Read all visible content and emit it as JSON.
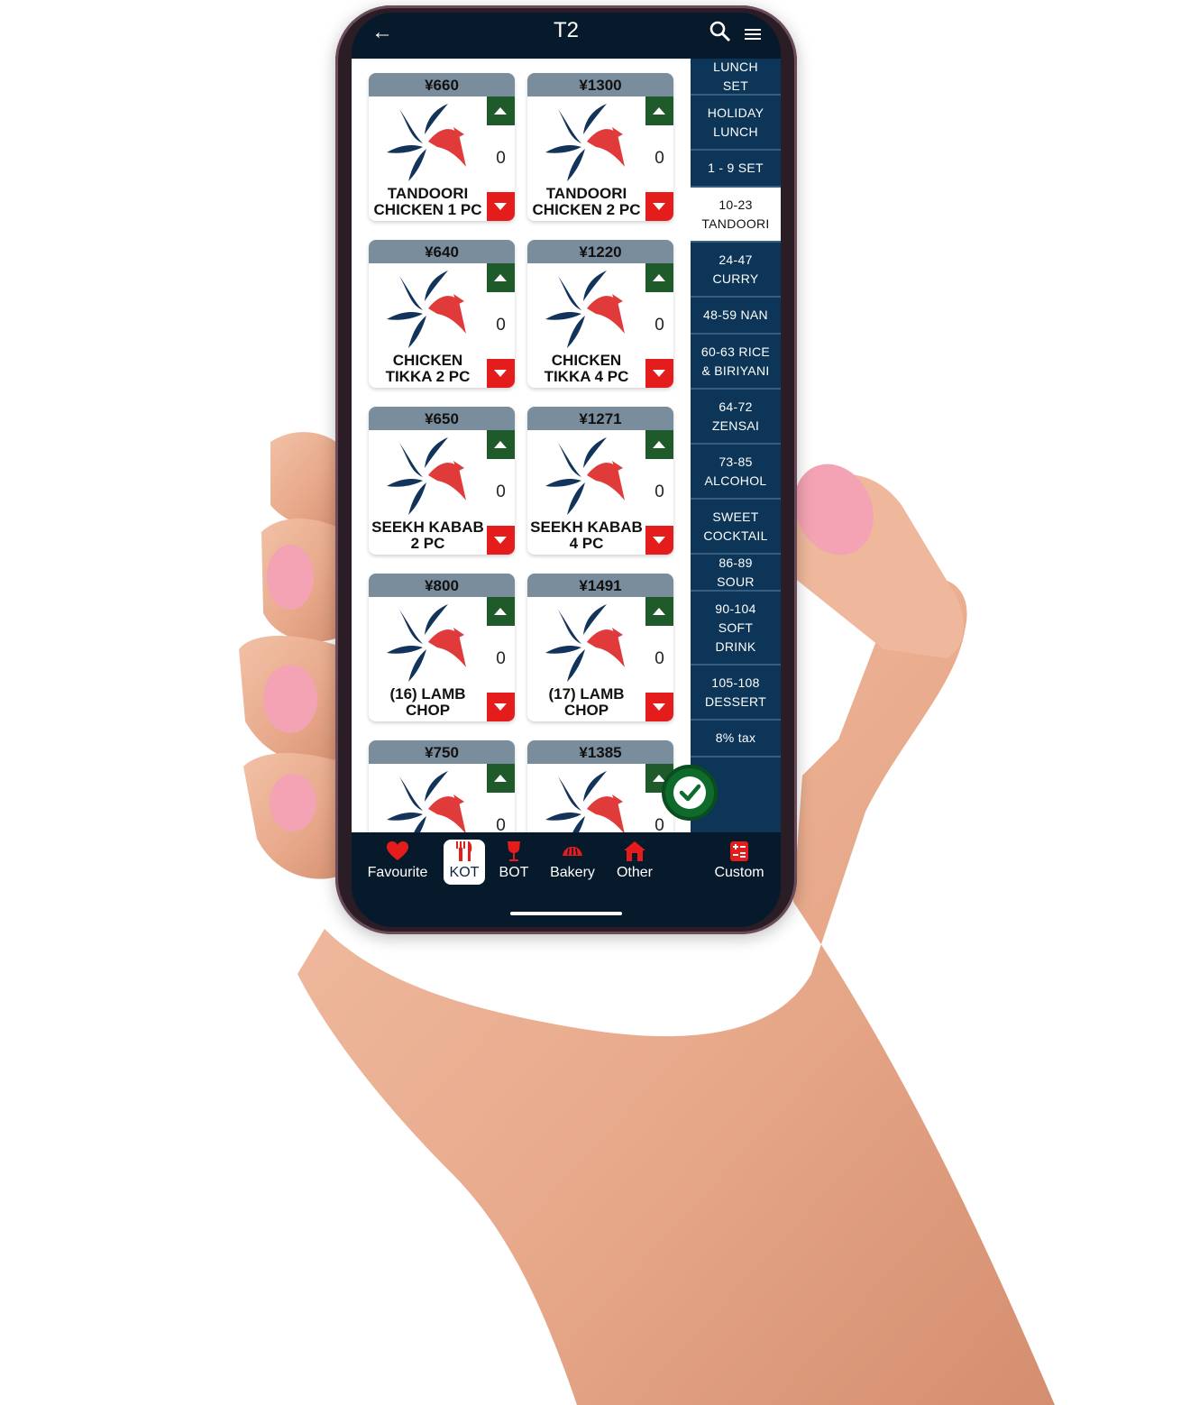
{
  "header": {
    "title": "T2",
    "back_icon": "back-arrow-icon",
    "search_icon": "search-icon",
    "menu_icon": "list-menu-icon"
  },
  "products": [
    {
      "price": "¥660",
      "name": "TANDOORI CHICKEN 1 PC",
      "qty": "0"
    },
    {
      "price": "¥1300",
      "name": "TANDOORI CHICKEN 2 PC",
      "qty": "0"
    },
    {
      "price": "¥640",
      "name": "CHICKEN TIKKA 2 PC",
      "qty": "0"
    },
    {
      "price": "¥1220",
      "name": "CHICKEN TIKKA 4 PC",
      "qty": "0"
    },
    {
      "price": "¥650",
      "name": "SEEKH KABAB 2 PC",
      "qty": "0"
    },
    {
      "price": "¥1271",
      "name": "SEEKH KABAB 4 PC",
      "qty": "0"
    },
    {
      "price": "¥800",
      "name": "(16) LAMB CHOP",
      "qty": "0"
    },
    {
      "price": "¥1491",
      "name": "(17) LAMB CHOP",
      "qty": "0"
    },
    {
      "price": "¥750",
      "name": "",
      "qty": "0"
    },
    {
      "price": "¥1385",
      "name": "",
      "qty": "0"
    }
  ],
  "categories": [
    {
      "label": "LUNCH SET"
    },
    {
      "label": "HOLIDAY LUNCH"
    },
    {
      "label": "1 - 9 SET"
    },
    {
      "label": "10-23 TANDOORI",
      "active": true
    },
    {
      "label": "24-47 CURRY"
    },
    {
      "label": "48-59 NAN"
    },
    {
      "label": "60-63 RICE & BIRIYANI"
    },
    {
      "label": "64-72 ZENSAI"
    },
    {
      "label": "73-85 ALCOHOL"
    },
    {
      "label": "SWEET COCKTAIL"
    },
    {
      "label": "86-89 SOUR"
    },
    {
      "label": "90-104 SOFT DRINK"
    },
    {
      "label": "105-108 DESSERT"
    },
    {
      "label": "8% tax"
    }
  ],
  "bottom_nav": [
    {
      "label": "Favourite",
      "icon": "heart-icon"
    },
    {
      "label": "KOT",
      "icon": "fork-knife-icon",
      "active": true
    },
    {
      "label": "BOT",
      "icon": "wine-glass-icon"
    },
    {
      "label": "Bakery",
      "icon": "bakery-icon"
    },
    {
      "label": "Other",
      "icon": "house-icon"
    },
    {
      "label": "Custom",
      "icon": "calculator-icon"
    }
  ],
  "colors": {
    "accent": "#e41c1c",
    "nav_bg": "#061a2c",
    "sidebar_bg": "#0c3558",
    "up_green": "#1f5a2b",
    "price_bar": "#7a8d9c"
  }
}
